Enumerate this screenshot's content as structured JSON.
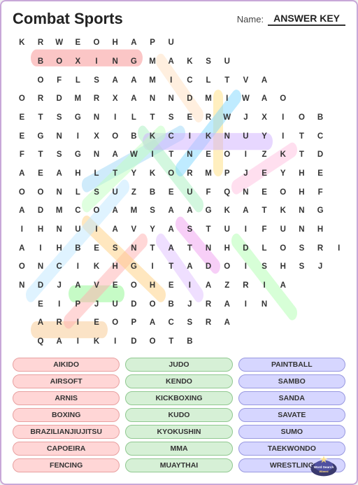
{
  "header": {
    "title": "Combat Sports",
    "name_label": "Name:",
    "name_value": "ANSWER KEY"
  },
  "grid": {
    "rows": [
      [
        "K",
        "R",
        "W",
        "E",
        "O",
        "H",
        "A",
        "P",
        "U",
        "",
        "",
        "",
        "",
        "",
        "",
        "",
        "",
        ""
      ],
      [
        "",
        "B",
        "O",
        "X",
        "I",
        "N",
        "G",
        "M",
        "A",
        "K",
        "S",
        "U",
        "",
        "",
        "",
        "",
        "",
        ""
      ],
      [
        "",
        "O",
        "F",
        "L",
        "S",
        "A",
        "A",
        "M",
        "I",
        "C",
        "L",
        "T",
        "V",
        "A",
        "",
        "",
        "",
        ""
      ],
      [
        "O",
        "R",
        "D",
        "M",
        "R",
        "X",
        "A",
        "N",
        "N",
        "D",
        "M",
        "I",
        "W",
        "A",
        "O",
        "",
        "",
        ""
      ],
      [
        "E",
        "T",
        "S",
        "G",
        "N",
        "I",
        "L",
        "T",
        "S",
        "E",
        "R",
        "W",
        "J",
        "X",
        "I",
        "O",
        "B",
        ""
      ],
      [
        "E",
        "G",
        "N",
        "I",
        "X",
        "O",
        "B",
        "K",
        "C",
        "I",
        "K",
        "N",
        "U",
        "Y",
        "I",
        "T",
        "C",
        ""
      ],
      [
        "F",
        "T",
        "S",
        "G",
        "N",
        "A",
        "W",
        "I",
        "T",
        "N",
        "E",
        "O",
        "I",
        "Z",
        "K",
        "T",
        "D",
        ""
      ],
      [
        "A",
        "E",
        "A",
        "H",
        "L",
        "T",
        "Y",
        "K",
        "O",
        "R",
        "M",
        "P",
        "J",
        "E",
        "Y",
        "H",
        "E",
        ""
      ],
      [
        "O",
        "O",
        "N",
        "L",
        "S",
        "U",
        "Z",
        "B",
        "E",
        "U",
        "F",
        "Q",
        "N",
        "E",
        "O",
        "H",
        "F",
        ""
      ],
      [
        "A",
        "D",
        "M",
        "C",
        "O",
        "A",
        "M",
        "S",
        "A",
        "A",
        "G",
        "K",
        "A",
        "T",
        "K",
        "N",
        "G",
        ""
      ],
      [
        "I",
        "H",
        "N",
        "U",
        "I",
        "A",
        "V",
        "Y",
        "A",
        "S",
        "T",
        "U",
        "I",
        "F",
        "U",
        "N",
        "H",
        ""
      ],
      [
        "A",
        "I",
        "H",
        "B",
        "E",
        "S",
        "N",
        "T",
        "A",
        "T",
        "N",
        "H",
        "D",
        "L",
        "O",
        "S",
        "R",
        "I"
      ],
      [
        "O",
        "N",
        "C",
        "I",
        "K",
        "H",
        "G",
        "I",
        "T",
        "A",
        "D",
        "O",
        "I",
        "S",
        "H",
        "S",
        "J",
        ""
      ],
      [
        "N",
        "D",
        "J",
        "A",
        "V",
        "E",
        "O",
        "H",
        "E",
        "I",
        "A",
        "Z",
        "R",
        "I",
        "A",
        "",
        "",
        ""
      ],
      [
        "",
        "E",
        "I",
        "P",
        "J",
        "U",
        "D",
        "O",
        "B",
        "J",
        "R",
        "A",
        "I",
        "N",
        "",
        "",
        "",
        ""
      ],
      [
        "",
        "A",
        "R",
        "I",
        "E",
        "O",
        "P",
        "A",
        "C",
        "S",
        "R",
        "A",
        "",
        "",
        "",
        "",
        "",
        ""
      ],
      [
        "",
        "Q",
        "A",
        "I",
        "K",
        "I",
        "D",
        "O",
        "T",
        "B",
        "",
        "",
        "",
        "",
        "",
        "",
        "",
        ""
      ]
    ]
  },
  "words": {
    "col1": [
      "AIKIDO",
      "AIRSOFT",
      "ARNIS",
      "BOXING",
      "BRAZILIANJIUJITSU",
      "CAPOEIRA",
      "FENCING"
    ],
    "col2": [
      "JUDO",
      "KENDO",
      "KICKBOXING",
      "KUDO",
      "KYOKUSHIN",
      "MMA",
      "MUAYTHAI"
    ],
    "col3": [
      "PAINTBALL",
      "SAMBO",
      "SANDA",
      "SAVATE",
      "SUMO",
      "TAEKWONDO",
      "WRESTLING"
    ]
  },
  "logo": {
    "line1": "Word Search",
    "line2": "Wizard"
  }
}
